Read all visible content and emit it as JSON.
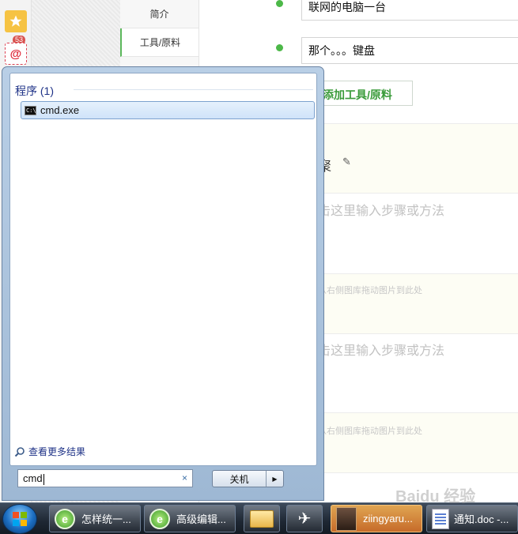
{
  "left_rail": {
    "badge_count": "53",
    "at_symbol": "@"
  },
  "tabs": {
    "intro": "简介",
    "tools": "工具/原料"
  },
  "tools": {
    "items": [
      "联网的电脑一台",
      "那个。。。键盘"
    ],
    "add_button": "添加工具/原料"
  },
  "steps": {
    "title": "聚",
    "prompt": "击这里输入步骤或方法",
    "image_hint": "从右侧图库拖动图片到此处"
  },
  "start_menu": {
    "section_header": "程序 (1)",
    "result": {
      "label": "cmd.exe",
      "icon_text": "C:\\"
    },
    "more_results": "查看更多结果",
    "search": {
      "value": "cmd",
      "clear": "×"
    },
    "shutdown": {
      "label": "关机",
      "arrow": "▶"
    }
  },
  "taskbar": {
    "items": [
      {
        "label": "怎样统一..."
      },
      {
        "label": "高级编辑..."
      },
      {
        "label": "ziingyaru..."
      },
      {
        "label": "通知.doc -..."
      }
    ],
    "active_color": "#d98c3f"
  },
  "watermark": "Baidu 经验"
}
